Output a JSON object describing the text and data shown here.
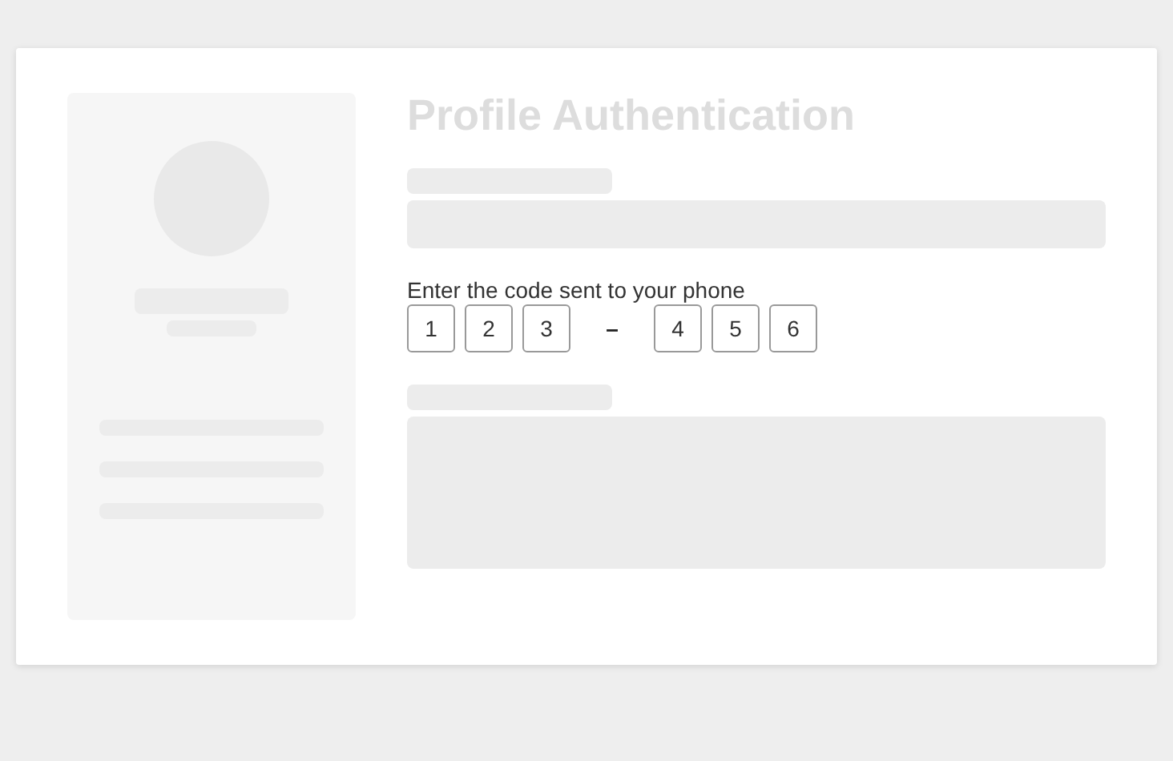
{
  "title": "Profile Authentication",
  "code_prompt": "Enter the code sent to your phone",
  "code_digits": [
    "1",
    "2",
    "3",
    "4",
    "5",
    "6"
  ],
  "code_separator": "–"
}
